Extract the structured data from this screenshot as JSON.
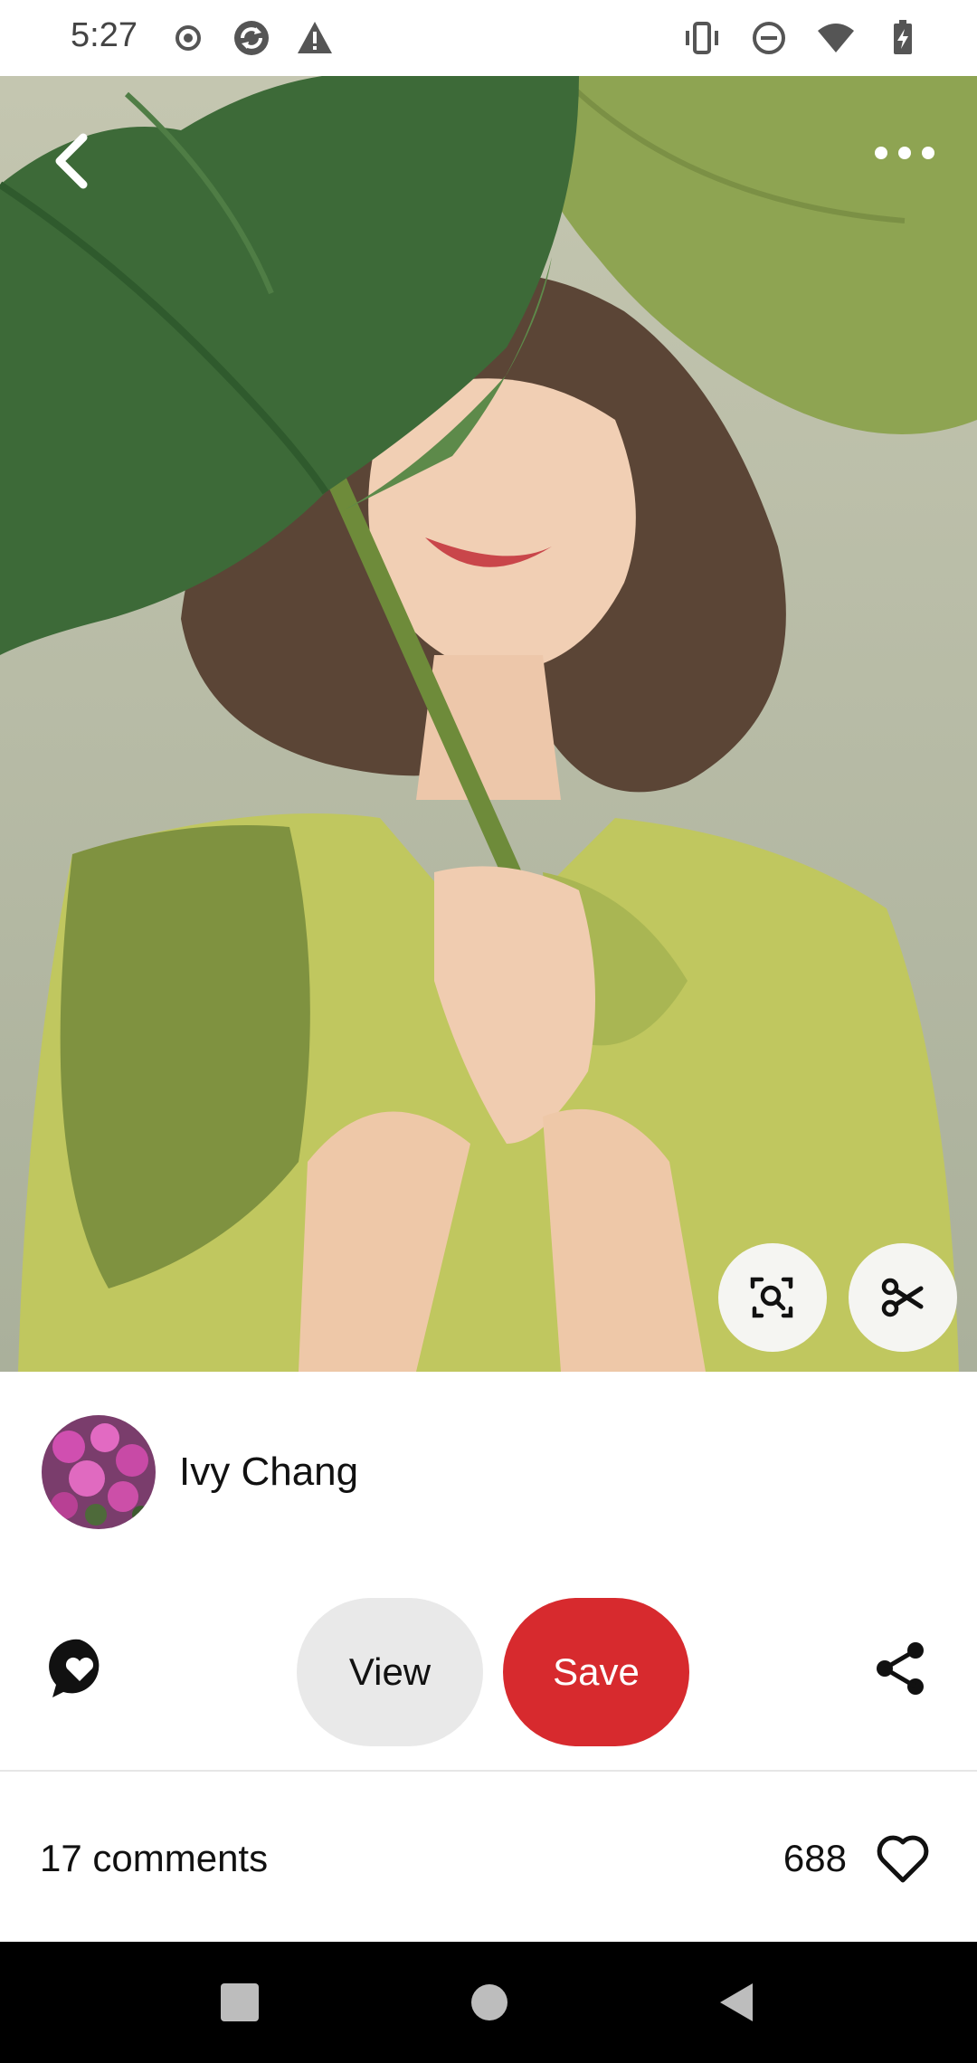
{
  "status_bar": {
    "time": "5:27",
    "left_icons": [
      "record-icon",
      "sync-icon",
      "warning-icon"
    ],
    "right_icons": [
      "vibrate-icon",
      "do-not-disturb-icon",
      "wifi-icon",
      "battery-charging-icon"
    ]
  },
  "pin": {
    "image_icons": [
      "back-arrow-icon",
      "more-dots-icon",
      "visual-search-icon",
      "scissors-icon"
    ]
  },
  "creator": {
    "name": "Ivy Chang",
    "avatar_icon": "orchid-photo"
  },
  "actions": {
    "comment_icon": "comment-heart-icon",
    "view_label": "View",
    "save_label": "Save",
    "share_icon": "share-icon"
  },
  "engagement": {
    "comments_label": "17 comments",
    "likes_count": "688",
    "heart_icon": "heart-outline-icon"
  },
  "nav_bar": {
    "icons": [
      "recents-square-icon",
      "home-circle-icon",
      "back-triangle-icon"
    ]
  },
  "colors": {
    "save_button": "#d72a2e",
    "view_button": "#e9e9e9",
    "nav_bar": "#000000"
  }
}
